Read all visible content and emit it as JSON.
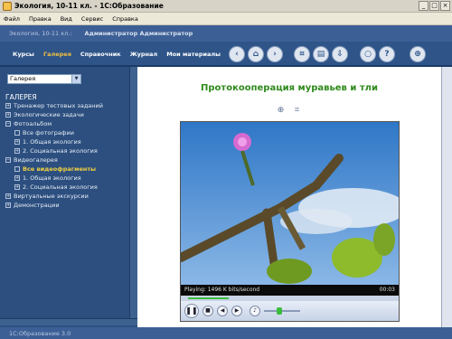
{
  "window": {
    "title": "Экология, 10-11 кл. - 1С:Образование"
  },
  "menu": [
    "Файл",
    "Правка",
    "Вид",
    "Сервис",
    "Справка"
  ],
  "header": {
    "course": "Экология, 10-11 кл.:",
    "user": "Администратор Администратор"
  },
  "nav": {
    "tabs": [
      "Курсы",
      "Галерея",
      "Справочник",
      "Журнал",
      "Мои материалы"
    ],
    "active_tab": "Галерея",
    "tools": [
      "back-icon",
      "home-icon",
      "forward-icon",
      "crop-icon",
      "print-icon",
      "export-icon",
      "search-icon",
      "help-icon",
      "zoom-icon"
    ]
  },
  "sidebar": {
    "select_value": "Галерея",
    "tree": {
      "heading": "ГАЛЕРЕЯ",
      "items": [
        "Тренажер тестовых заданий",
        "Экологические задачи",
        "Фотоальбом",
        "Все фотографии",
        "1. Общая экология",
        "2. Социальная экология",
        "Видеогалерея",
        "Все видеофрагменты",
        "1. Общая экология",
        "2. Социальная экология",
        "Виртуальные экскурсии",
        "Демонстрации"
      ],
      "selected": "Все видеофрагменты"
    }
  },
  "content": {
    "title": "Протокооперация муравьев и тли",
    "player": {
      "status_text": "Playing: 1496 K bits/second",
      "time": "00:03",
      "progress": 0.2,
      "volume": 0.4
    }
  },
  "footer": {
    "text": "1С:Образование 3.0"
  },
  "colors": {
    "panel_blue": "#2c4f7f",
    "active_tab": "#f0c040",
    "title_green": "#2e8a1c",
    "selected_item": "#f0d040"
  }
}
